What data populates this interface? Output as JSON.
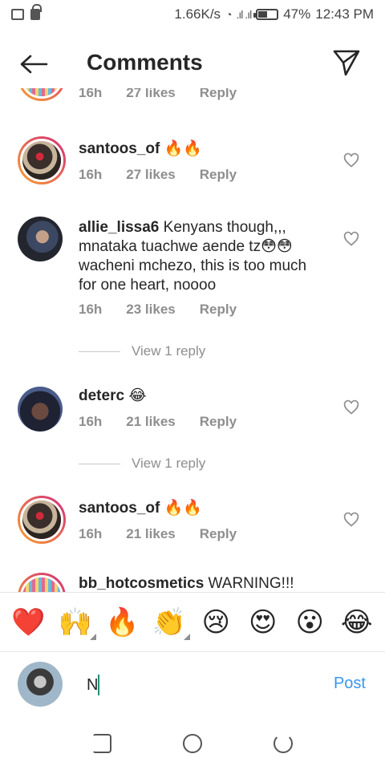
{
  "status_bar": {
    "network_speed": "1.66K/s",
    "battery_percent": "47%",
    "battery_level": 0.47,
    "time": "12:43 PM"
  },
  "header": {
    "title": "Comments",
    "back_icon": "back-arrow-icon",
    "send_icon": "direct-send-icon"
  },
  "top_partial": {
    "time": "16h",
    "likes": "27 likes",
    "reply": "Reply"
  },
  "comments": [
    {
      "username": "santoos_of",
      "text": "🔥🔥",
      "time": "16h",
      "likes": "27 likes",
      "reply": "Reply"
    },
    {
      "username": "allie_lissa6",
      "text": "Kenyans though,,, mnataka tuachwe aende tz😳😳wacheni mchezo, this is too much for one heart, noooo",
      "time": "16h",
      "likes": "23 likes",
      "reply": "Reply",
      "view_replies": "View 1 reply"
    },
    {
      "username": "deterc",
      "text": "😂",
      "time": "16h",
      "likes": "21 likes",
      "reply": "Reply",
      "view_replies": "View 1 reply"
    },
    {
      "username": "santoos_of",
      "text": "🔥🔥",
      "time": "16h",
      "likes": "21 likes",
      "reply": "Reply"
    },
    {
      "username": "bb_hotcosmetics",
      "text": "WARNING!!!"
    }
  ],
  "emoji_bar": [
    "❤️",
    "🙌",
    "🔥",
    "👏",
    "😢",
    "😍",
    "😮",
    "😂"
  ],
  "composer": {
    "input_value": "N",
    "post_label": "Post"
  },
  "colors": {
    "accent_blue": "#3897f0",
    "meta_gray": "#8e8e8e",
    "text": "#262626"
  }
}
